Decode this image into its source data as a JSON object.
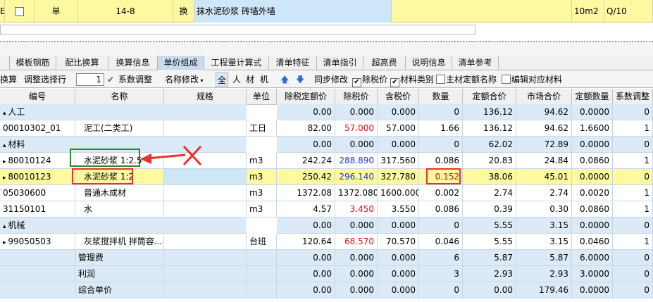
{
  "top_row": {
    "col1": "E",
    "type": "单",
    "code": "14-8",
    "flag": "换",
    "name": "抹水泥砂浆 砖墙外墙",
    "unit": "10m2",
    "qty": "Q/10"
  },
  "tabs": [
    {
      "label": "模板钢筋"
    },
    {
      "label": "配比换算"
    },
    {
      "label": "换算信息"
    },
    {
      "label": "单价组成"
    },
    {
      "label": "工程量计算式"
    },
    {
      "label": "清单特征"
    },
    {
      "label": "清单指引"
    },
    {
      "label": "超高费"
    },
    {
      "label": "说明信息"
    },
    {
      "label": "清单参考"
    }
  ],
  "toolbar": {
    "convert": "换算",
    "adjust_select": "调整选择行",
    "adjust_value": "1",
    "coef_adjust": "系数调整",
    "name_modify": "名称修改",
    "filter_all": "全",
    "filter_labor": "人",
    "filter_material": "材",
    "filter_machine": "机",
    "sync_modify": "同步修改",
    "exclude_tax": "除税价",
    "material_category": "材料类别",
    "main_quota_name": "主材定额名称",
    "edit_material": "编辑对应材料"
  },
  "table": {
    "headers": [
      "编号",
      "名称",
      "规格",
      "单位",
      "除税定额价",
      "除税价",
      "含税价",
      "数量",
      "定额合价",
      "市场合价",
      "定额数量",
      "系数调整"
    ],
    "rows": [
      {
        "type": "group",
        "label": "人工",
        "cells": [
          "",
          "",
          "",
          "",
          "0.00",
          "0.000",
          "0.000",
          "0",
          "136.12",
          "94.62",
          "0.0000",
          "0"
        ]
      },
      {
        "type": "item",
        "cells": [
          "00010302_01",
          "泥工(二类工)",
          "",
          "工日",
          "82.00",
          "57.000",
          "57.000",
          "1.66",
          "136.12",
          "94.62",
          "1.6600",
          "1"
        ]
      },
      {
        "type": "group",
        "label": "材料",
        "cells": [
          "",
          "",
          "",
          "",
          "0.00",
          "0.000",
          "0.000",
          "0",
          "62.02",
          "72.89",
          "0.0000",
          "0"
        ]
      },
      {
        "type": "item",
        "arrow": true,
        "cells": [
          "80010124",
          "水泥砂浆 1:2.5",
          "",
          "m3",
          "242.24",
          "288.890",
          "317.560",
          "0.086",
          "20.83",
          "24.84",
          "0.0860",
          "1"
        ]
      },
      {
        "type": "selected",
        "arrow": true,
        "cells": [
          "80010123",
          "水泥砂浆 1:2",
          "",
          "m3",
          "250.42",
          "296.140",
          "327.780",
          "0.152",
          "38.06",
          "45.01",
          "0.0000",
          "0"
        ]
      },
      {
        "type": "item",
        "cells": [
          "05030600",
          "普通木成材",
          "",
          "m3",
          "1372.08",
          "1372.080",
          "1600.000",
          "0.002",
          "2.74",
          "2.74",
          "0.0020",
          "1"
        ]
      },
      {
        "type": "item",
        "cells": [
          "31150101",
          "水",
          "",
          "m3",
          "4.57",
          "3.450",
          "3.550",
          "0.086",
          "0.39",
          "0.30",
          "0.0860",
          "1"
        ]
      },
      {
        "type": "group",
        "label": "机械",
        "cells": [
          "",
          "",
          "",
          "",
          "0.00",
          "0.000",
          "0.000",
          "0",
          "5.55",
          "3.15",
          "0.0000",
          "0"
        ]
      },
      {
        "type": "item",
        "arrow": true,
        "cells": [
          "99050503",
          "灰浆搅拌机 拌筒容...",
          "",
          "台班",
          "120.64",
          "68.570",
          "70.570",
          "0.046",
          "5.55",
          "3.15",
          "0.0460",
          "1"
        ]
      },
      {
        "type": "sum",
        "cells": [
          "",
          "管理费",
          "",
          "",
          "0.00",
          "0.000",
          "0.000",
          "6",
          "5.87",
          "5.87",
          "6.0000",
          "0"
        ]
      },
      {
        "type": "sum",
        "cells": [
          "",
          "利润",
          "",
          "",
          "0.00",
          "0.000",
          "0.000",
          "3",
          "2.93",
          "2.93",
          "3.0000",
          "0"
        ]
      },
      {
        "type": "sum",
        "cells": [
          "",
          "综合单价",
          "",
          "",
          "0.00",
          "0.000",
          "0.000",
          "0",
          "0.00",
          "179.46",
          "0.0000",
          "0"
        ]
      }
    ]
  },
  "colors": {
    "selected_row": "#fdf9a0",
    "group_row": "#dbeaf6",
    "red_value": "#e01010",
    "blue_value": "#1c35c8",
    "annot_green": "#2a8a2a",
    "annot_red": "#e8322a"
  }
}
